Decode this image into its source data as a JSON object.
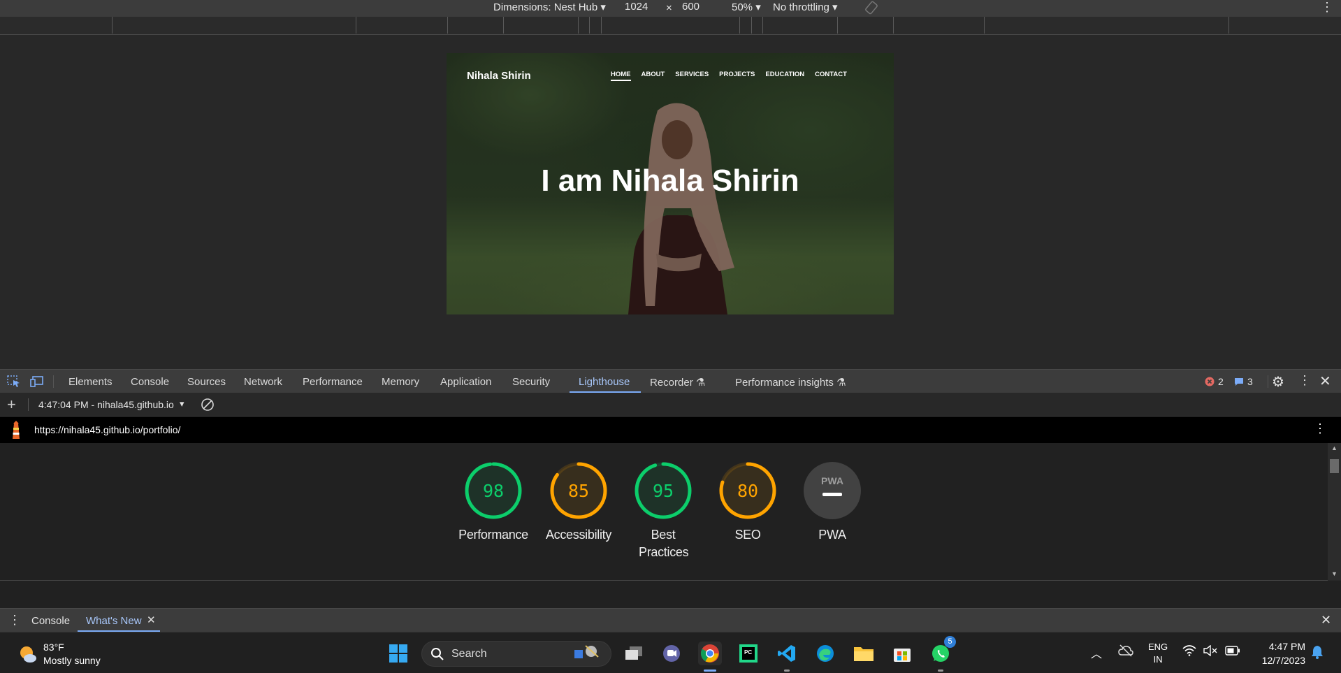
{
  "device_toolbar": {
    "dimensions_label": "Dimensions: Nest Hub",
    "width": "1024",
    "times": "×",
    "height": "600",
    "zoom": "50%",
    "throttling": "No throttling"
  },
  "site": {
    "brand": "Nihala Shirin",
    "nav": [
      "HOME",
      "ABOUT",
      "SERVICES",
      "PROJECTS",
      "EDUCATION",
      "CONTACT"
    ],
    "hero": "I am Nihala Shirin"
  },
  "devtools": {
    "tabs": [
      "Elements",
      "Console",
      "Sources",
      "Network",
      "Performance",
      "Memory",
      "Application",
      "Security",
      "Lighthouse",
      "Recorder",
      "Performance insights"
    ],
    "active_tab": "Lighthouse",
    "error_count": "2",
    "message_count": "3"
  },
  "lighthouse": {
    "report_selector": "4:47:04 PM - nihala45.github.io",
    "url": "https://nihala45.github.io/portfolio/",
    "scores": [
      {
        "label": "Performance",
        "score": 98,
        "color": "#0cce6b"
      },
      {
        "label": "Accessibility",
        "score": 85,
        "color": "#ffa400"
      },
      {
        "label": "Best Practices",
        "score": 95,
        "color": "#0cce6b"
      },
      {
        "label": "SEO",
        "score": 80,
        "color": "#ffa400"
      }
    ],
    "pwa_label": "PWA",
    "pwa_badge": "PWA"
  },
  "drawer": {
    "tabs": [
      "Console",
      "What's New"
    ],
    "active_tab": "What's New"
  },
  "taskbar": {
    "weather_temp": "83°F",
    "weather_desc": "Mostly sunny",
    "search_label": "Search",
    "whatsapp_badge": "5",
    "lang_top": "ENG",
    "lang_bottom": "IN",
    "time": "4:47 PM",
    "date": "12/7/2023"
  }
}
